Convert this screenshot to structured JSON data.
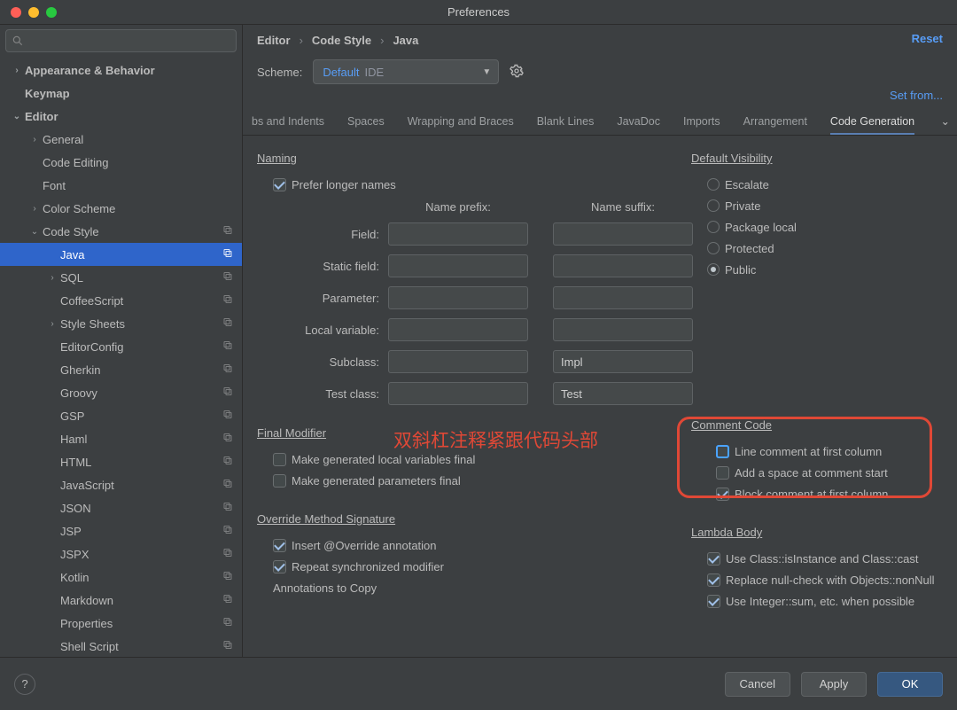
{
  "window": {
    "title": "Preferences"
  },
  "search": {
    "placeholder": ""
  },
  "sidebar": {
    "items": [
      {
        "label": "Appearance & Behavior",
        "depth": 0,
        "exp": "›",
        "bold": true
      },
      {
        "label": "Keymap",
        "depth": 0,
        "exp": "",
        "bold": true
      },
      {
        "label": "Editor",
        "depth": 0,
        "exp": "⌄",
        "bold": true
      },
      {
        "label": "General",
        "depth": 1,
        "exp": "›"
      },
      {
        "label": "Code Editing",
        "depth": 1,
        "exp": ""
      },
      {
        "label": "Font",
        "depth": 1,
        "exp": ""
      },
      {
        "label": "Color Scheme",
        "depth": 1,
        "exp": "›"
      },
      {
        "label": "Code Style",
        "depth": 1,
        "exp": "⌄",
        "copy": true
      },
      {
        "label": "Java",
        "depth": 2,
        "exp": "",
        "copy": true,
        "selected": true
      },
      {
        "label": "SQL",
        "depth": 2,
        "exp": "›",
        "copy": true
      },
      {
        "label": "CoffeeScript",
        "depth": 2,
        "exp": "",
        "copy": true
      },
      {
        "label": "Style Sheets",
        "depth": 2,
        "exp": "›",
        "copy": true
      },
      {
        "label": "EditorConfig",
        "depth": 2,
        "exp": "",
        "copy": true
      },
      {
        "label": "Gherkin",
        "depth": 2,
        "exp": "",
        "copy": true
      },
      {
        "label": "Groovy",
        "depth": 2,
        "exp": "",
        "copy": true
      },
      {
        "label": "GSP",
        "depth": 2,
        "exp": "",
        "copy": true
      },
      {
        "label": "Haml",
        "depth": 2,
        "exp": "",
        "copy": true
      },
      {
        "label": "HTML",
        "depth": 2,
        "exp": "",
        "copy": true
      },
      {
        "label": "JavaScript",
        "depth": 2,
        "exp": "",
        "copy": true
      },
      {
        "label": "JSON",
        "depth": 2,
        "exp": "",
        "copy": true
      },
      {
        "label": "JSP",
        "depth": 2,
        "exp": "",
        "copy": true
      },
      {
        "label": "JSPX",
        "depth": 2,
        "exp": "",
        "copy": true
      },
      {
        "label": "Kotlin",
        "depth": 2,
        "exp": "",
        "copy": true
      },
      {
        "label": "Markdown",
        "depth": 2,
        "exp": "",
        "copy": true
      },
      {
        "label": "Properties",
        "depth": 2,
        "exp": "",
        "copy": true
      },
      {
        "label": "Shell Script",
        "depth": 2,
        "exp": "",
        "copy": true
      }
    ]
  },
  "breadcrumbs": [
    "Editor",
    "Code Style",
    "Java"
  ],
  "reset_label": "Reset",
  "scheme": {
    "label": "Scheme:",
    "name": "Default",
    "suffix": "IDE"
  },
  "setfrom": "Set from...",
  "tabs": [
    "bs and Indents",
    "Spaces",
    "Wrapping and Braces",
    "Blank Lines",
    "JavaDoc",
    "Imports",
    "Arrangement",
    "Code Generation"
  ],
  "active_tab": 7,
  "naming": {
    "title": "Naming",
    "prefer": "Prefer longer names",
    "col_prefix": "Name prefix:",
    "col_suffix": "Name suffix:",
    "rows": [
      {
        "label": "Field:",
        "prefix": "",
        "suffix": ""
      },
      {
        "label": "Static field:",
        "prefix": "",
        "suffix": ""
      },
      {
        "label": "Parameter:",
        "prefix": "",
        "suffix": ""
      },
      {
        "label": "Local variable:",
        "prefix": "",
        "suffix": ""
      },
      {
        "label": "Subclass:",
        "prefix": "",
        "suffix": "Impl"
      },
      {
        "label": "Test class:",
        "prefix": "",
        "suffix": "Test"
      }
    ]
  },
  "visibility": {
    "title": "Default Visibility",
    "options": [
      "Escalate",
      "Private",
      "Package local",
      "Protected",
      "Public"
    ],
    "selected": 4
  },
  "final_mod": {
    "title": "Final Modifier",
    "opts": [
      {
        "label": "Make generated local variables final",
        "checked": false
      },
      {
        "label": "Make generated parameters final",
        "checked": false
      }
    ]
  },
  "comment": {
    "title": "Comment Code",
    "opts": [
      {
        "label": "Line comment at first column",
        "checked": false,
        "hi": true
      },
      {
        "label": "Add a space at comment start",
        "checked": false
      },
      {
        "label": "Block comment at first column",
        "checked": true
      }
    ]
  },
  "override": {
    "title": "Override Method Signature",
    "opts": [
      {
        "label": "Insert @Override annotation",
        "checked": true
      },
      {
        "label": "Repeat synchronized modifier",
        "checked": true
      }
    ],
    "annot": "Annotations to Copy"
  },
  "lambda": {
    "title": "Lambda Body",
    "opts": [
      {
        "label": "Use Class::isInstance and Class::cast",
        "checked": true
      },
      {
        "label": "Replace null-check with Objects::nonNull",
        "checked": true
      },
      {
        "label": "Use Integer::sum, etc. when possible",
        "checked": true
      }
    ]
  },
  "annotation_cn": "双斜杠注释紧跟代码头部",
  "buttons": {
    "cancel": "Cancel",
    "apply": "Apply",
    "ok": "OK"
  }
}
